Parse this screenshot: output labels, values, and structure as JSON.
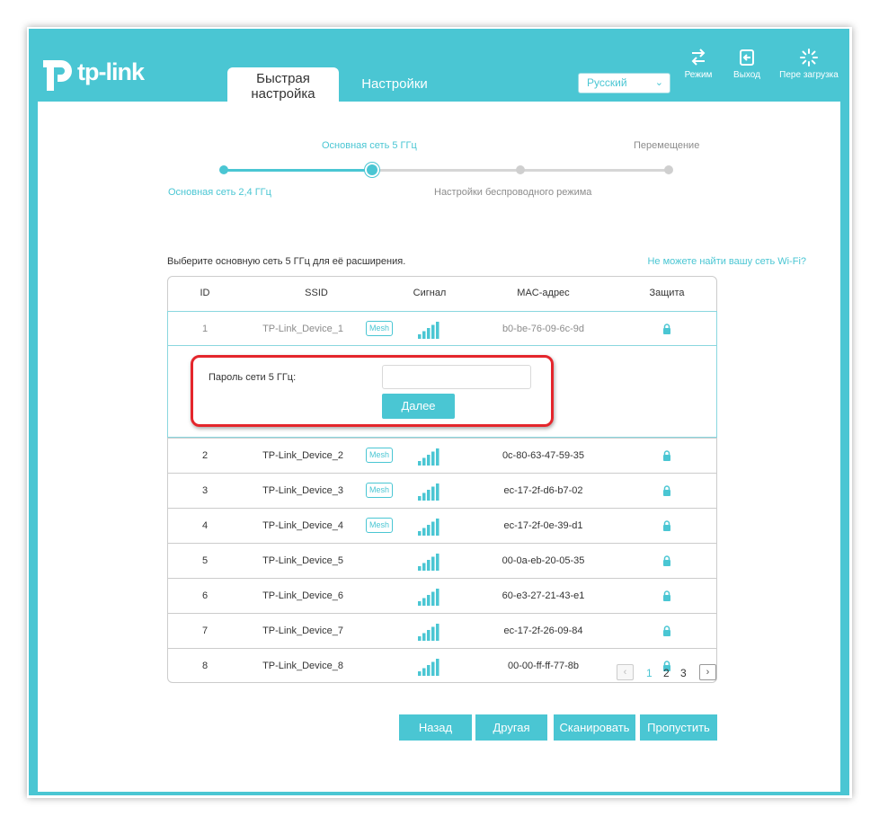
{
  "header": {
    "logo_text": "tp-link",
    "tabs": [
      {
        "label": "Быстрая настройка",
        "active": true
      },
      {
        "label": "Настройки",
        "active": false
      }
    ],
    "language": "Русский",
    "buttons": [
      {
        "label": "Режим",
        "icon": "mode-switch-icon"
      },
      {
        "label": "Выход",
        "icon": "logout-icon"
      },
      {
        "label": "Пере загрузка",
        "icon": "reboot-icon"
      }
    ]
  },
  "stepper": {
    "steps": [
      {
        "label": "Основная сеть 2,4 ГГц",
        "state": "done"
      },
      {
        "label": "Основная сеть 5 ГГц",
        "state": "current"
      },
      {
        "label": "Настройки беспроводного режима",
        "state": "pending"
      },
      {
        "label": "Перемещение",
        "state": "pending"
      }
    ]
  },
  "main": {
    "prompt": "Выберите основную сеть 5 ГГц для её расширения.",
    "cant_find_link": "Не можете найти вашу сеть Wi-Fi?",
    "table": {
      "columns": [
        "ID",
        "SSID",
        "Сигнал",
        "MAC-адрес",
        "Защита"
      ],
      "rows": [
        {
          "id": "1",
          "ssid": "TP-Link_Device_1",
          "mesh": "Mesh",
          "mac": "b0-be-76-09-6c-9d",
          "selected": true
        },
        {
          "id": "2",
          "ssid": "TP-Link_Device_2",
          "mesh": "Mesh",
          "mac": "0c-80-63-47-59-35"
        },
        {
          "id": "3",
          "ssid": "TP-Link_Device_3",
          "mesh": "Mesh",
          "mac": "ec-17-2f-d6-b7-02"
        },
        {
          "id": "4",
          "ssid": "TP-Link_Device_4",
          "mesh": "Mesh",
          "mac": "ec-17-2f-0e-39-d1"
        },
        {
          "id": "5",
          "ssid": "TP-Link_Device_5",
          "mesh": "",
          "mac": "00-0a-eb-20-05-35"
        },
        {
          "id": "6",
          "ssid": "TP-Link_Device_6",
          "mesh": "",
          "mac": "60-e3-27-21-43-e1"
        },
        {
          "id": "7",
          "ssid": "TP-Link_Device_7",
          "mesh": "",
          "mac": "ec-17-2f-26-09-84"
        },
        {
          "id": "8",
          "ssid": "TP-Link_Device_8",
          "mesh": "",
          "mac": "00-00-ff-ff-77-8b"
        }
      ]
    },
    "password_panel": {
      "label": "Пароль сети 5 ГГц:",
      "value": "",
      "next_button": "Далее"
    },
    "pagination": {
      "pages": [
        "1",
        "2",
        "3"
      ],
      "current": "1",
      "prev": "‹",
      "next": "›"
    },
    "buttons": {
      "back": "Назад",
      "other": "Другая",
      "scan": "Сканировать",
      "skip": "Пропустить"
    }
  },
  "colors": {
    "accent": "#4ac6d3",
    "highlight": "#e4262c"
  }
}
